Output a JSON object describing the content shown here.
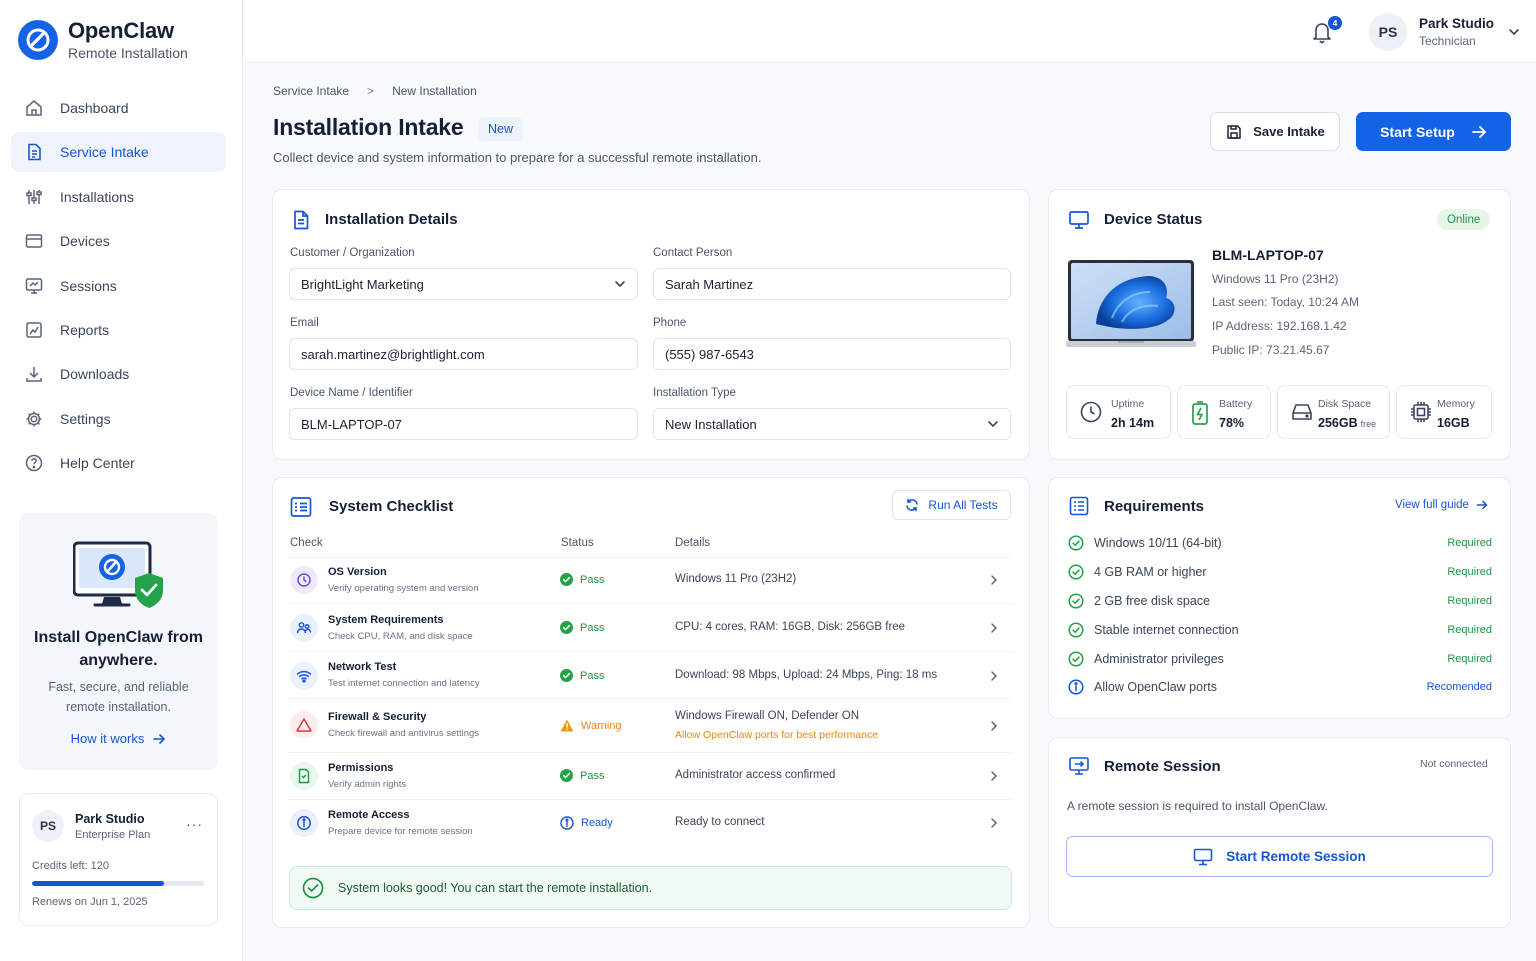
{
  "app": {
    "name": "OpenClaw",
    "subtitle": "Remote Installation"
  },
  "sidebar": {
    "items": [
      {
        "label": "Dashboard",
        "icon": "home-icon"
      },
      {
        "label": "Service Intake",
        "icon": "document-icon",
        "active": true
      },
      {
        "label": "Installations",
        "icon": "sliders-icon"
      },
      {
        "label": "Devices",
        "icon": "device-icon"
      },
      {
        "label": "Sessions",
        "icon": "monitor-icon"
      },
      {
        "label": "Reports",
        "icon": "chart-icon"
      },
      {
        "label": "Downloads",
        "icon": "download-icon"
      },
      {
        "label": "Settings",
        "icon": "gear-icon"
      },
      {
        "label": "Help Center",
        "icon": "help-icon"
      }
    ],
    "promo": {
      "title": "Install OpenClaw from anywhere.",
      "desc": "Fast, secure, and reliable remote installation.",
      "link": "How it works"
    },
    "account": {
      "initials": "PS",
      "name": "Park Studio",
      "plan": "Enterprise Plan",
      "credits": "Credits left: 120",
      "credits_fraction": 0.77,
      "renews": "Renews on Jun 1, 2025",
      "more": "···"
    }
  },
  "topbar": {
    "notifications": "4",
    "initials": "PS",
    "user_name": "Park Studio",
    "user_role": "Technician"
  },
  "header": {
    "breadcrumb": [
      "Service Intake",
      "New Installation"
    ],
    "breadcrumb_sep": ">",
    "title": "Installation Intake",
    "badge": "New",
    "description": "Collect device and system information to prepare for a successful remote installation.",
    "save_label": "Save Intake",
    "start_label": "Start Setup"
  },
  "details": {
    "title": "Installation Details",
    "customer_label": "Customer / Organization",
    "customer": "BrightLight Marketing",
    "contact_label": "Contact Person",
    "contact": "Sarah Martinez",
    "email_label": "Email",
    "email": "sarah.martinez@brightlight.com",
    "phone_label": "Phone",
    "phone": "(555) 987-6543",
    "device_label": "Device Name / Identifier",
    "device": "BLM-LAPTOP-07",
    "type_label": "Installation Type",
    "type": "New Installation"
  },
  "device_status": {
    "title": "Device Status",
    "status": "Online",
    "name": "BLM-LAPTOP-07",
    "os": "Windows 11 Pro (23H2)",
    "last_seen": "Last seen: Today, 10:24 AM",
    "ip": "IP Address: 192.168.1.42",
    "public_ip": "Public IP: 73.21.45.67",
    "stats": {
      "uptime_label": "Uptime",
      "uptime": "2h 14m",
      "battery_label": "Battery",
      "battery": "78%",
      "disk_label": "Disk Space",
      "disk": "256GB",
      "disk_suffix": "free",
      "memory_label": "Memory",
      "memory": "16GB"
    }
  },
  "checklist": {
    "title": "System Checklist",
    "run_label": "Run All Tests",
    "col_check": "Check",
    "col_status": "Status",
    "col_details": "Details",
    "rows": [
      {
        "title": "OS Version",
        "sub": "Verify operating system and version",
        "status": "Pass",
        "details": "Windows 11 Pro (23H2)"
      },
      {
        "title": "System Requirements",
        "sub": "Check CPU, RAM, and disk space",
        "status": "Pass",
        "details": "CPU: 4 cores, RAM: 16GB, Disk: 256GB free"
      },
      {
        "title": "Network Test",
        "sub": "Test internet connection and latency",
        "status": "Pass",
        "details": "Download: 98 Mbps, Upload: 24 Mbps, Ping: 18 ms"
      },
      {
        "title": "Firewall & Security",
        "sub": "Check firewall and antivirus settings",
        "status": "Warning",
        "details": "Windows Firewall ON, Defender ON",
        "note": "Allow OpenClaw ports for best performance"
      },
      {
        "title": "Permissions",
        "sub": "Verify admin rights",
        "status": "Pass",
        "details": "Administrator access confirmed"
      },
      {
        "title": "Remote Access",
        "sub": "Prepare device for remote session",
        "status": "Ready",
        "details": "Ready to connect"
      }
    ],
    "banner": "System looks good! You can start the remote installation."
  },
  "requirements": {
    "title": "Requirements",
    "link": "View full guide",
    "items": [
      {
        "label": "Windows 10/11 (64-bit)",
        "badge": "Required"
      },
      {
        "label": "4 GB RAM or higher",
        "badge": "Required"
      },
      {
        "label": "2 GB free disk space",
        "badge": "Required"
      },
      {
        "label": "Stable internet connection",
        "badge": "Required"
      },
      {
        "label": "Administrator privileges",
        "badge": "Required"
      },
      {
        "label": "Allow OpenClaw ports",
        "badge": "Recomended"
      }
    ]
  },
  "remote_session": {
    "title": "Remote Session",
    "status": "Not connected",
    "description": "A remote session is required to install OpenClaw.",
    "button": "Start Remote Session"
  },
  "colors": {
    "accent": "#1463e6",
    "success": "#1e9445",
    "warning": "#e8860f"
  }
}
